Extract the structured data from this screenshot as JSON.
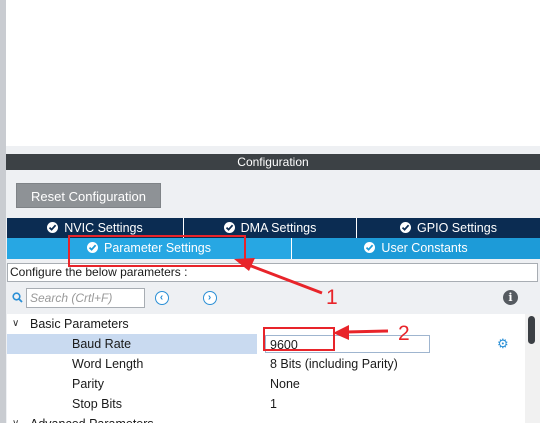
{
  "config": {
    "header": "Configuration",
    "reset_label": "Reset Configuration"
  },
  "tabs": {
    "row1": [
      "NVIC Settings",
      "DMA Settings",
      "GPIO Settings"
    ],
    "row2": [
      "Parameter Settings",
      "User Constants"
    ],
    "active": "Parameter Settings"
  },
  "description": "Configure the below parameters :",
  "search": {
    "placeholder": "Search (Crtl+F)"
  },
  "tree": {
    "group_basic": "Basic Parameters",
    "group_advanced": "Advanced Parameters",
    "params": [
      {
        "name": "Baud Rate",
        "value": "9600"
      },
      {
        "name": "Word Length",
        "value": "8 Bits (including Parity)"
      },
      {
        "name": "Parity",
        "value": "None"
      },
      {
        "name": "Stop Bits",
        "value": "1"
      }
    ]
  },
  "annotations": {
    "label1": "1",
    "label2": "2",
    "color": "#e8242a"
  },
  "colors": {
    "header_bg": "#3c4145",
    "tab_dark": "#0b2c52",
    "tab_blue": "#1d9bd8",
    "selected_row": "#c9daf0",
    "accent": "#2a8fd6"
  },
  "icons": [
    "check-icon",
    "search-icon",
    "prev-icon",
    "next-icon",
    "info-icon",
    "chevron-down-icon",
    "chevron-right-icon",
    "gear-icon"
  ]
}
